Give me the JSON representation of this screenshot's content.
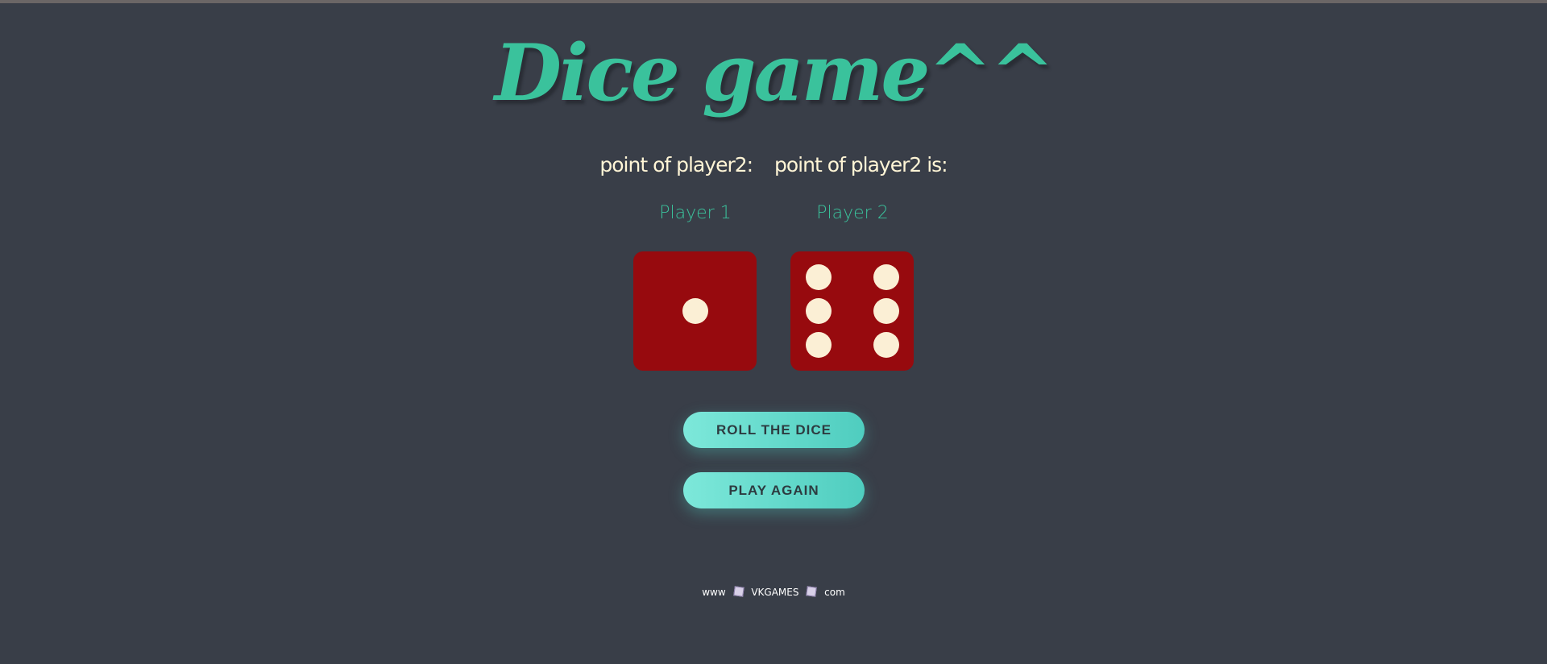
{
  "title": "Dice game^^",
  "scores": {
    "player1_text": "point of player2:",
    "player2_text": "point of player2 is:"
  },
  "players": [
    {
      "label": "Player 1",
      "die_value": 1
    },
    {
      "label": "Player 2",
      "die_value": 6
    }
  ],
  "buttons": {
    "roll": "ROLL THE DICE",
    "again": "PLAY AGAIN"
  },
  "footer": {
    "prefix": "www",
    "site": "VKGAMES",
    "suffix": "com"
  },
  "colors": {
    "background": "#393e48",
    "accent": "#3ac29c",
    "die": "#970a0e",
    "pip": "#fbefd5",
    "score_text": "#fff5d6"
  }
}
